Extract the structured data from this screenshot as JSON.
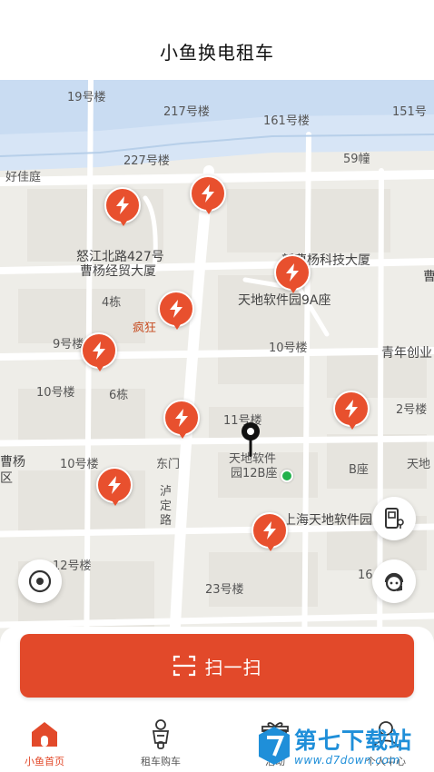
{
  "header": {
    "title": "小鱼换电租车"
  },
  "map": {
    "labels": {
      "l1": "19号楼",
      "l2": "217号楼",
      "l3": "161号楼",
      "l4": "151号",
      "l5": "227号楼",
      "l6": "59幢",
      "l7": "好佳庭",
      "l8": "怒江北路427号",
      "l9": "曹杨经贸大厦",
      "l10": "新曹杨科技大厦",
      "l11": "曹",
      "l12": "4栋",
      "l13": "天地软件园9A座",
      "l14": "疯狂",
      "l15": "9号楼",
      "l16": "10号楼",
      "l17": "青年创业",
      "l18": "10号楼",
      "l19": "6栋",
      "l20": "11号楼",
      "l21": "2号楼",
      "l22": "曹杨",
      "l23": "区",
      "l24": "10号楼",
      "l25": "东门",
      "l26": "天地软件",
      "l27": "园12B座",
      "l28": "B座",
      "l29": "天地",
      "l30": "泸",
      "l31": "定",
      "l32": "路",
      "l33": "上海天地软件园",
      "l34": "12号楼",
      "l35": "23号楼",
      "l36": "16"
    },
    "marker_icon": "lightning-bolt-icon"
  },
  "scan_button": {
    "label": "扫一扫",
    "icon": "scan-frame-icon"
  },
  "tabs": [
    {
      "label": "小鱼首页",
      "icon": "home-icon",
      "active": true
    },
    {
      "label": "租车购车",
      "icon": "scooter-icon",
      "active": false
    },
    {
      "label": "活动",
      "icon": "gift-icon",
      "active": false
    },
    {
      "label": "个人中心",
      "icon": "user-icon",
      "active": false
    }
  ],
  "watermark": {
    "name": "第七下载站",
    "url": "www.d7down.com"
  },
  "colors": {
    "accent": "#e2492a",
    "marker": "#e8502e",
    "map_bg": "#eeede8",
    "water": "#c9dcf2",
    "road": "#ffffff",
    "watermark": "#1f8fd9"
  }
}
